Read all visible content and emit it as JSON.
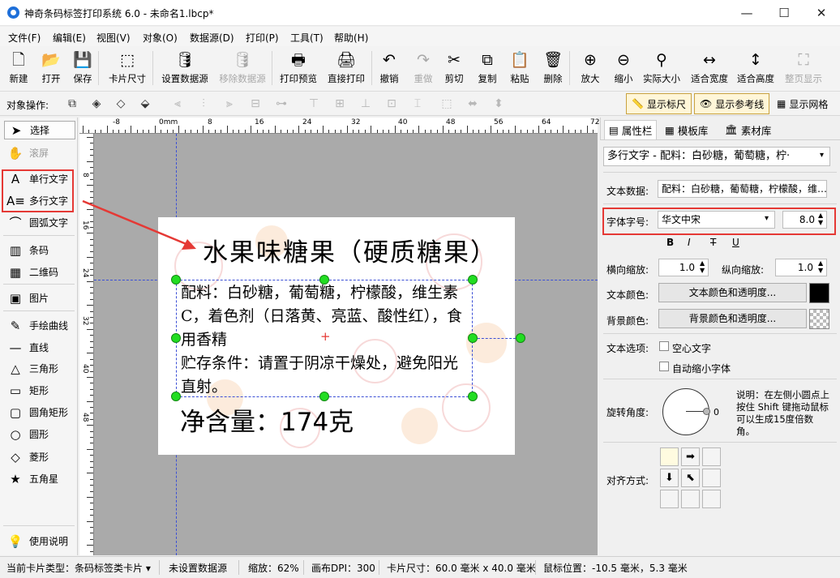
{
  "window": {
    "title": "神奇条码标签打印系统 6.0 - 未命名1.lbcp*",
    "minimize": "—",
    "maximize": "☐",
    "close": "✕"
  },
  "menu": [
    "文件(F)",
    "编辑(E)",
    "视图(V)",
    "对象(O)",
    "数据源(D)",
    "打印(P)",
    "工具(T)",
    "帮助(H)"
  ],
  "toolbar": [
    {
      "label": "新建",
      "icon": "new-file-icon",
      "glyph": "🗋"
    },
    {
      "label": "打开",
      "icon": "open-icon",
      "glyph": "📂"
    },
    {
      "label": "保存",
      "icon": "save-icon",
      "glyph": "💾"
    },
    {
      "label": "卡片尺寸",
      "icon": "card-size-icon",
      "glyph": "⬚"
    },
    {
      "label": "设置数据源",
      "icon": "database-icon",
      "glyph": "🛢"
    },
    {
      "label": "移除数据源",
      "icon": "remove-database-icon",
      "glyph": "🛢",
      "disabled": true
    },
    {
      "label": "打印预览",
      "icon": "print-preview-icon",
      "glyph": "🖶"
    },
    {
      "label": "直接打印",
      "icon": "print-icon",
      "glyph": "🖨"
    },
    {
      "label": "撤销",
      "icon": "undo-icon",
      "glyph": "↶"
    },
    {
      "label": "重做",
      "icon": "redo-icon",
      "glyph": "↷",
      "disabled": true
    },
    {
      "label": "剪切",
      "icon": "cut-icon",
      "glyph": "✂"
    },
    {
      "label": "复制",
      "icon": "copy-icon",
      "glyph": "⧉"
    },
    {
      "label": "粘贴",
      "icon": "paste-icon",
      "glyph": "📋"
    },
    {
      "label": "删除",
      "icon": "delete-icon",
      "glyph": "🗑"
    },
    {
      "label": "放大",
      "icon": "zoom-in-icon",
      "glyph": "⊕"
    },
    {
      "label": "缩小",
      "icon": "zoom-out-icon",
      "glyph": "⊖"
    },
    {
      "label": "实际大小",
      "icon": "actual-size-icon",
      "glyph": "⚲"
    },
    {
      "label": "适合宽度",
      "icon": "fit-width-icon",
      "glyph": "↔"
    },
    {
      "label": "适合高度",
      "icon": "fit-height-icon",
      "glyph": "↕"
    },
    {
      "label": "整页显示",
      "icon": "full-page-icon",
      "glyph": "⛶",
      "disabled": true
    }
  ],
  "toolbar2": {
    "label": "对象操作:",
    "show_ruler": "显示标尺",
    "show_guides": "显示参考线",
    "show_grid": "显示网格"
  },
  "tools": [
    {
      "label": "选择",
      "icon": "pointer-icon",
      "glyph": "➤",
      "selected": true
    },
    {
      "label": "滚屏",
      "icon": "hand-icon",
      "glyph": "✋",
      "disabled": true
    },
    {
      "label": "单行文字",
      "icon": "single-line-text-icon",
      "glyph": "A"
    },
    {
      "label": "多行文字",
      "icon": "multi-line-text-icon",
      "glyph": "A≡"
    },
    {
      "label": "圆弧文字",
      "icon": "arc-text-icon",
      "glyph": "⌒"
    },
    {
      "label": "条码",
      "icon": "barcode-icon",
      "glyph": "▥"
    },
    {
      "label": "二维码",
      "icon": "qrcode-icon",
      "glyph": "▦"
    },
    {
      "label": "图片",
      "icon": "image-icon",
      "glyph": "▣"
    },
    {
      "label": "手绘曲线",
      "icon": "pencil-icon",
      "glyph": "✎"
    },
    {
      "label": "直线",
      "icon": "line-icon",
      "glyph": "—"
    },
    {
      "label": "三角形",
      "icon": "triangle-icon",
      "glyph": "△"
    },
    {
      "label": "矩形",
      "icon": "rectangle-icon",
      "glyph": "▭"
    },
    {
      "label": "圆角矩形",
      "icon": "rounded-rectangle-icon",
      "glyph": "▢"
    },
    {
      "label": "圆形",
      "icon": "circle-icon",
      "glyph": "○"
    },
    {
      "label": "菱形",
      "icon": "diamond-icon",
      "glyph": "◇"
    },
    {
      "label": "五角星",
      "icon": "star-icon",
      "glyph": "★"
    },
    {
      "label": "使用说明",
      "icon": "lightbulb-icon",
      "glyph": "💡"
    }
  ],
  "ruler": {
    "h": [
      "-8",
      "0mm",
      "8",
      "16",
      "24",
      "32",
      "40",
      "48",
      "56",
      "64",
      "72"
    ],
    "v": [
      "8",
      "16",
      "24",
      "32",
      "40",
      "48"
    ]
  },
  "card": {
    "title": "水果味糖果（硬质糖果）",
    "body": "配料：白砂糖，葡萄糖，柠檬酸，维生素C，着色剂（日落黄、亮蓝、酸性红），食用香精\n贮存条件：请置于阴凉干燥处，避免阳光直射。",
    "net": "净含量：174克"
  },
  "panel": {
    "tabs": [
      {
        "label": "属性栏",
        "icon": "properties-icon"
      },
      {
        "label": "模板库",
        "icon": "template-icon"
      },
      {
        "label": "素材库",
        "icon": "library-icon"
      }
    ],
    "object_select": "多行文字 - 配料：白砂糖，葡萄糖，柠·",
    "text_data_label": "文本数据:",
    "text_data_value": "配料：白砂糖，葡萄糖，柠檬酸，维…",
    "font_label": "字体字号:",
    "font_name": "华文中宋",
    "font_size": "8.0",
    "style_buttons": [
      "B",
      "I",
      "T",
      "U"
    ],
    "hscale_label": "横向缩放:",
    "hscale": "1.0",
    "vscale_label": "纵向缩放:",
    "vscale": "1.0",
    "text_color_label": "文本颜色:",
    "text_color_btn": "文本颜色和透明度...",
    "text_color": "#000000",
    "bg_color_label": "背景颜色:",
    "bg_color_btn": "背景颜色和透明度...",
    "text_option_label": "文本选项:",
    "hollow_text": "空心文字",
    "auto_shrink": "自动缩小字体",
    "rotation_label": "旋转角度:",
    "rotation": "0",
    "rotation_hint": "说明：在左侧小圆点上按住 Shift 键拖动鼠标可以生成15度倍数角。",
    "align_label": "对齐方式:"
  },
  "status": [
    "当前卡片类型：条码标签类卡片 ▾",
    "未设置数据源",
    "缩放：62%",
    "画布DPI：300",
    "卡片尺寸：60.0 毫米 x 40.0 毫米",
    "鼠标位置：-10.5 毫米，5.3 毫米"
  ],
  "colors": {
    "accent": "#1e6fd9",
    "highlight": "#e53935",
    "handle": "#22dd22",
    "guide": "#3b4fd6"
  }
}
